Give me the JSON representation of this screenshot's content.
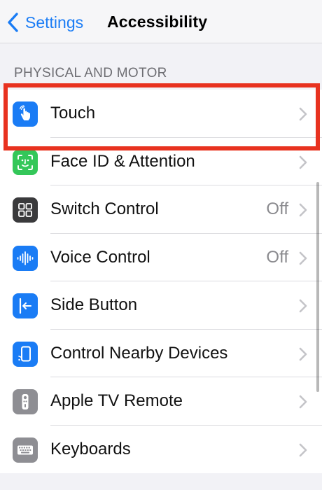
{
  "nav": {
    "back_label": "Settings",
    "title": "Accessibility"
  },
  "section_header": "PHYSICAL AND MOTOR",
  "rows": [
    {
      "label": "Touch",
      "value": "",
      "icon": "hand-tap-icon",
      "icon_color": "#1a7cf5",
      "highlighted": true
    },
    {
      "label": "Face ID & Attention",
      "value": "",
      "icon": "face-id-icon",
      "icon_color": "#34c759"
    },
    {
      "label": "Switch Control",
      "value": "Off",
      "icon": "switch-control-icon",
      "icon_color": "#3a3a3c"
    },
    {
      "label": "Voice Control",
      "value": "Off",
      "icon": "voice-control-icon",
      "icon_color": "#1a7cf5"
    },
    {
      "label": "Side Button",
      "value": "",
      "icon": "side-button-icon",
      "icon_color": "#1a7cf5"
    },
    {
      "label": "Control Nearby Devices",
      "value": "",
      "icon": "nearby-devices-icon",
      "icon_color": "#1a7cf5"
    },
    {
      "label": "Apple TV Remote",
      "value": "",
      "icon": "tv-remote-icon",
      "icon_color": "#8e8e93"
    },
    {
      "label": "Keyboards",
      "value": "",
      "icon": "keyboard-icon",
      "icon_color": "#8e8e93"
    }
  ],
  "colors": {
    "accent": "#1a7cf5",
    "highlight": "#e8321f",
    "background": "#f2f2f6"
  }
}
